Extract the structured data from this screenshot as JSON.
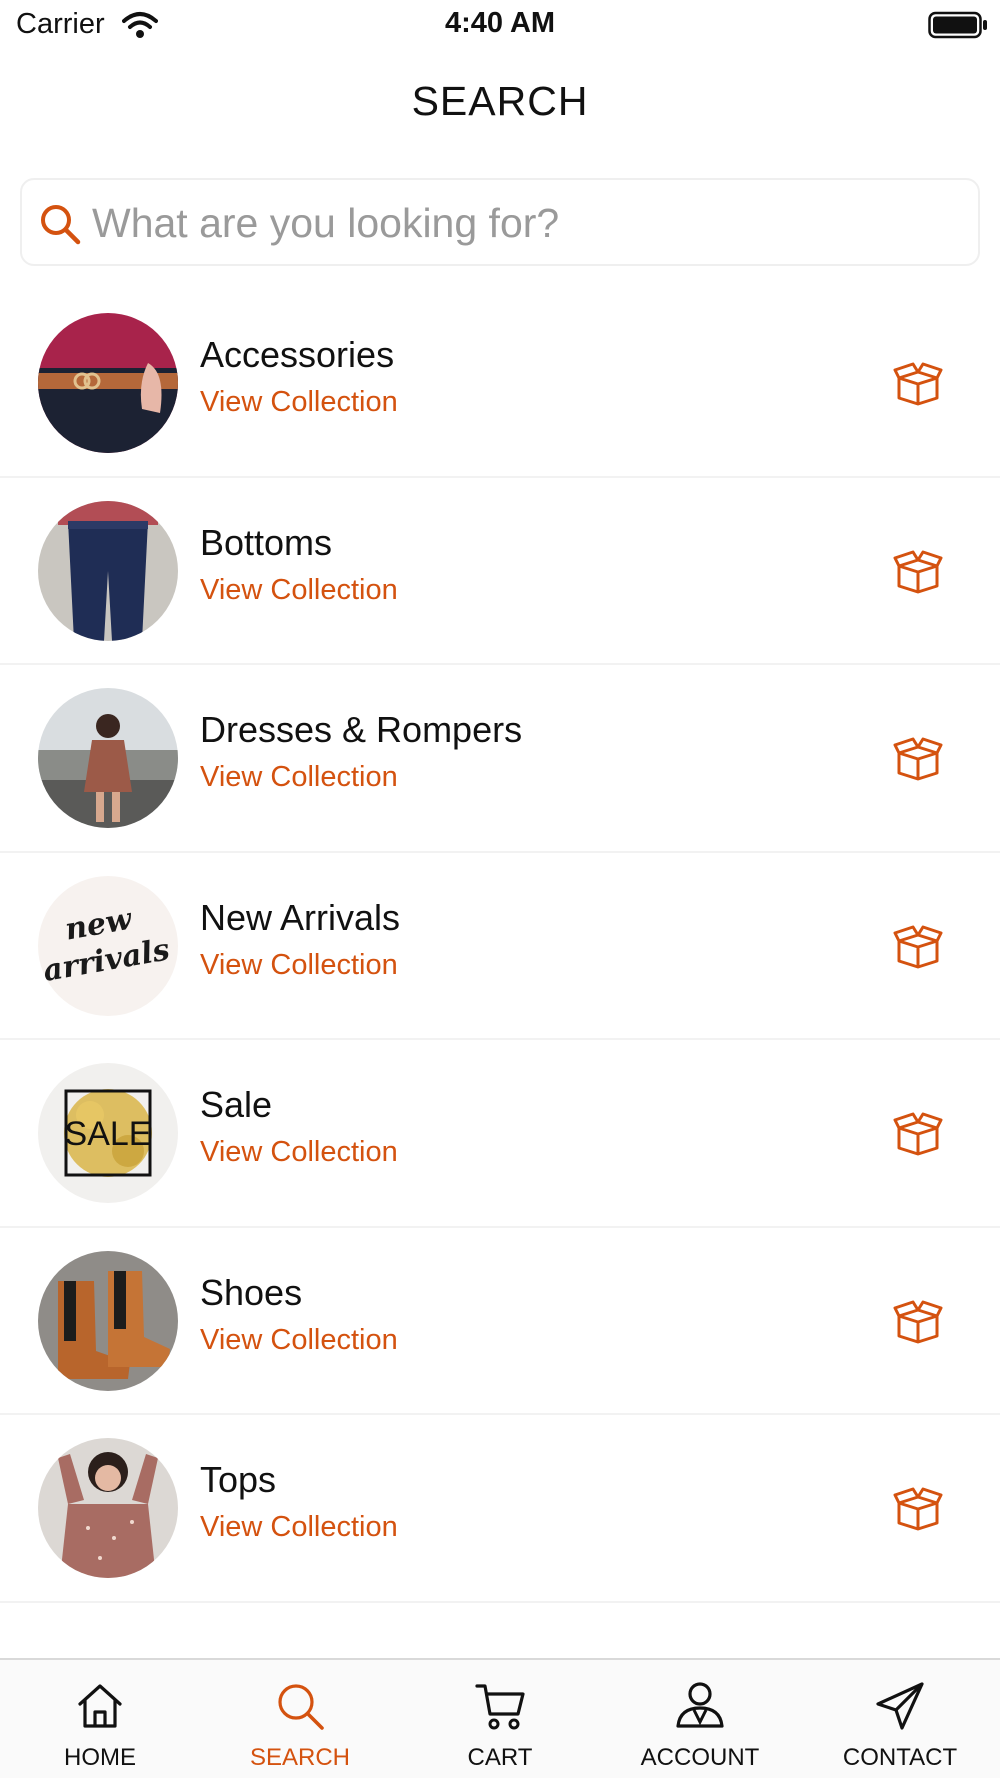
{
  "status_bar": {
    "carrier": "Carrier",
    "time": "4:40 AM"
  },
  "header": {
    "title": "SEARCH"
  },
  "search": {
    "placeholder": "What are you looking for?",
    "value": ""
  },
  "colors": {
    "accent": "#d4520f",
    "text": "#111111",
    "placeholder": "#9a9a9a",
    "divider": "#f2f2f2"
  },
  "collections": [
    {
      "title": "Accessories",
      "link": "View Collection",
      "icon": "open-box-icon"
    },
    {
      "title": "Bottoms",
      "link": "View Collection",
      "icon": "open-box-icon"
    },
    {
      "title": "Dresses & Rompers",
      "link": "View Collection",
      "icon": "open-box-icon"
    },
    {
      "title": "New Arrivals",
      "link": "View Collection",
      "icon": "open-box-icon"
    },
    {
      "title": "Sale",
      "link": "View Collection",
      "icon": "open-box-icon"
    },
    {
      "title": "Shoes",
      "link": "View Collection",
      "icon": "open-box-icon"
    },
    {
      "title": "Tops",
      "link": "View Collection",
      "icon": "open-box-icon"
    }
  ],
  "thumb_text": {
    "new_arrivals_line1": "new",
    "new_arrivals_line2": "arrivals",
    "sale": "SALE"
  },
  "tabs": [
    {
      "label": "HOME",
      "icon": "home-icon",
      "active": false
    },
    {
      "label": "SEARCH",
      "icon": "search-icon",
      "active": true
    },
    {
      "label": "CART",
      "icon": "cart-icon",
      "active": false
    },
    {
      "label": "ACCOUNT",
      "icon": "account-icon",
      "active": false
    },
    {
      "label": "CONTACT",
      "icon": "paper-plane-icon",
      "active": false
    }
  ]
}
